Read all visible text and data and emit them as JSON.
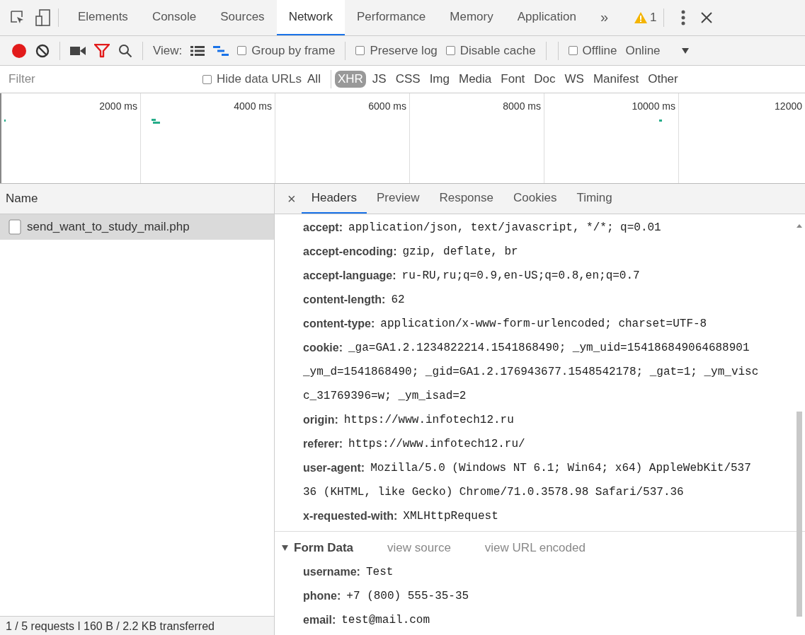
{
  "main_tabs": [
    {
      "label": "Elements",
      "selected": false
    },
    {
      "label": "Console",
      "selected": false
    },
    {
      "label": "Sources",
      "selected": false
    },
    {
      "label": "Network",
      "selected": true
    },
    {
      "label": "Performance",
      "selected": false
    },
    {
      "label": "Memory",
      "selected": false
    },
    {
      "label": "Application",
      "selected": false
    }
  ],
  "more_tabs": "»",
  "warning_count": "1",
  "toolbar": {
    "recording": true,
    "view_label": "View:",
    "large_rows": false,
    "overview": true,
    "checkboxes": [
      {
        "label": "Group by frame",
        "checked": false
      },
      {
        "label": "Preserve log",
        "checked": false
      },
      {
        "label": "Disable cache",
        "checked": false
      },
      {
        "label": "Offline",
        "checked": false
      }
    ],
    "throttling": "Online"
  },
  "filter_bar": {
    "placeholder": "Filter",
    "hide_data_urls": {
      "label": "Hide data URLs",
      "checked": false
    },
    "types": [
      {
        "label": "All",
        "selected": false
      },
      {
        "label": "XHR",
        "selected": true
      },
      {
        "label": "JS",
        "selected": false
      },
      {
        "label": "CSS",
        "selected": false
      },
      {
        "label": "Img",
        "selected": false
      },
      {
        "label": "Media",
        "selected": false
      },
      {
        "label": "Font",
        "selected": false
      },
      {
        "label": "Doc",
        "selected": false
      },
      {
        "label": "WS",
        "selected": false
      },
      {
        "label": "Manifest",
        "selected": false
      },
      {
        "label": "Other",
        "selected": false
      }
    ]
  },
  "overview": {
    "ticks": [
      "2000 ms",
      "4000 ms",
      "6000 ms",
      "8000 ms",
      "10000 ms",
      "12000"
    ]
  },
  "requests": {
    "column": "Name",
    "rows": [
      {
        "name": "send_want_to_study_mail.php",
        "selected": true
      }
    ]
  },
  "status_bar": "1 / 5 requests ǀ 160 B / 2.2 KB transferred",
  "detail_tabs": [
    {
      "label": "Headers",
      "selected": true
    },
    {
      "label": "Preview",
      "selected": false
    },
    {
      "label": "Response",
      "selected": false
    },
    {
      "label": "Cookies",
      "selected": false
    },
    {
      "label": "Timing",
      "selected": false
    }
  ],
  "close": "×",
  "headers": [
    {
      "name": "accept:",
      "lines": [
        "application/json, text/javascript, */*; q=0.01"
      ]
    },
    {
      "name": "accept-encoding:",
      "lines": [
        "gzip, deflate, br"
      ]
    },
    {
      "name": "accept-language:",
      "lines": [
        "ru-RU,ru;q=0.9,en-US;q=0.8,en;q=0.7"
      ]
    },
    {
      "name": "content-length:",
      "lines": [
        "62"
      ]
    },
    {
      "name": "content-type:",
      "lines": [
        "application/x-www-form-urlencoded; charset=UTF-8"
      ]
    },
    {
      "name": "cookie:",
      "lines": [
        "_ga=GA1.2.1234822214.1541868490; _ym_uid=154186849064688901",
        "_ym_d=1541868490; _gid=GA1.2.176943677.1548542178; _gat=1; _ym_visc",
        "c_31769396=w; _ym_isad=2"
      ]
    },
    {
      "name": "origin:",
      "lines": [
        "https://www.infotech12.ru"
      ]
    },
    {
      "name": "referer:",
      "lines": [
        "https://www.infotech12.ru/"
      ]
    },
    {
      "name": "user-agent:",
      "lines": [
        "Mozilla/5.0 (Windows NT 6.1; Win64; x64) AppleWebKit/537",
        "36 (KHTML, like Gecko) Chrome/71.0.3578.98 Safari/537.36"
      ]
    },
    {
      "name": "x-requested-with:",
      "lines": [
        "XMLHttpRequest"
      ]
    }
  ],
  "form_data": {
    "title": "Form Data",
    "expanded": true,
    "links": [
      "view source",
      "view URL encoded"
    ],
    "fields": [
      {
        "name": "username:",
        "value": "Test"
      },
      {
        "name": "phone:",
        "value": "+7 (800) 555-35-35"
      },
      {
        "name": "email:",
        "value": "test@mail.com"
      }
    ]
  }
}
